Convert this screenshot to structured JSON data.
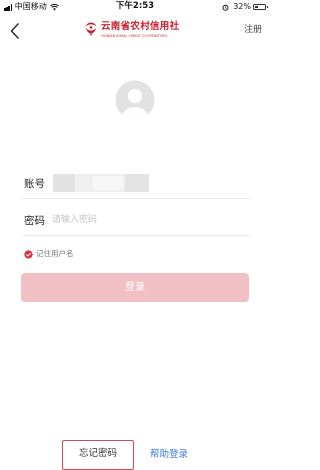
{
  "status_bar": {
    "carrier": "中国移动",
    "time": "下午2:53",
    "battery": "32%",
    "battery_level": 0.32,
    "icons": [
      "signal-icon",
      "wifi-icon",
      "alarm-icon",
      "battery-icon"
    ]
  },
  "nav": {
    "back_icon": "chevron-left-icon",
    "brand_name": "云南省农村信用社",
    "brand_subtitle": "YUNNAN RURAL CREDIT COOPERATIVES",
    "register": "注册"
  },
  "avatar_icon": "user-avatar-icon",
  "form": {
    "account_label": "账号",
    "account_value_masked": true,
    "password_label": "密码",
    "password_placeholder": "请输入密码",
    "remember_label": "记住用户名",
    "remember_checked": true,
    "login_button": "登录"
  },
  "footer": {
    "forgot": "忘记密码",
    "help": "帮助登录"
  },
  "colors": {
    "brand_red": "#c9202f",
    "login_button_disabled": "#f0c0c4",
    "link_blue": "#3a7bd5",
    "forgot_border": "#d44a52"
  }
}
